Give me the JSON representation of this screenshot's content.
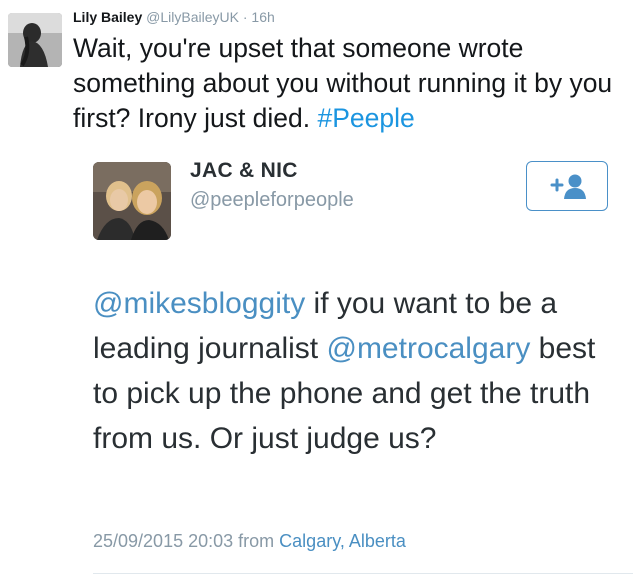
{
  "tweet": {
    "author_name": "Lily Bailey",
    "author_handle": "@LilyBaileyUK",
    "separator": "·",
    "time": "16h",
    "text_main": "Wait, you're upset that someone wrote something about you without running it by you first? Irony just died.",
    "hashtag": "#Peeple"
  },
  "embedded_tweet": {
    "author_name": "JAC & NIC",
    "author_handle": "@peepleforpeople",
    "follow_icon": "add-user-icon",
    "text": {
      "mention1": "@mikesbloggity",
      "part1": " if you want to be a leading journalist ",
      "mention2": "@metrocalgary",
      "part2": " best to pick up the phone and get the truth from us. Or just judge us?"
    },
    "timestamp": "25/09/2015 20:03",
    "from_label": "from",
    "location": "Calgary, Alberta"
  },
  "colors": {
    "link": "#1b95e0",
    "embed_link": "#4a8fc2",
    "muted": "#8899a6",
    "follow_border": "#4a90c8"
  }
}
